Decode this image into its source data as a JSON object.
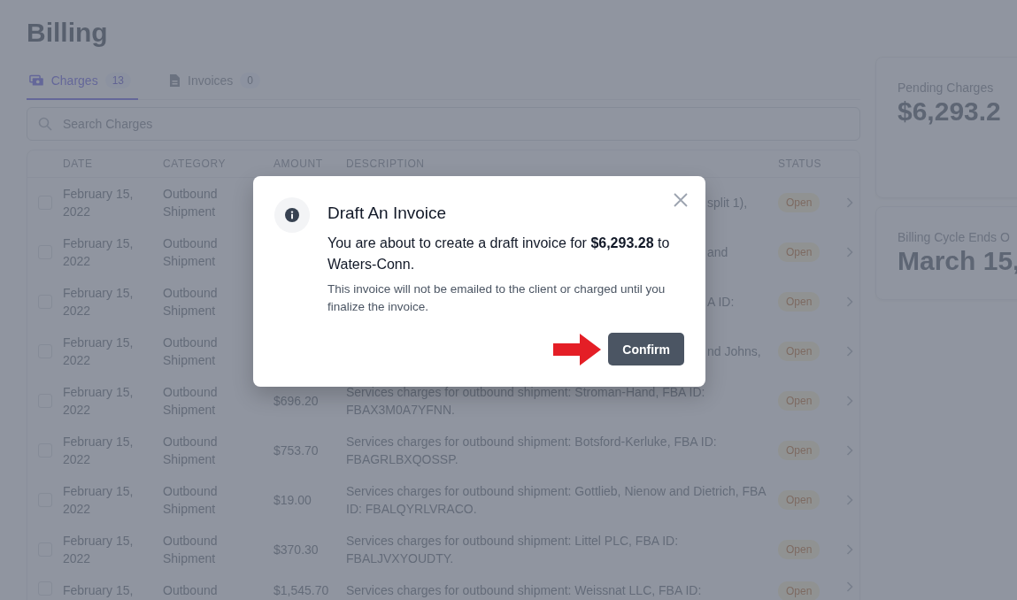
{
  "page": {
    "title": "Billing"
  },
  "tabs": [
    {
      "label": "Charges",
      "count": "13",
      "selected": true
    },
    {
      "label": "Invoices",
      "count": "0",
      "selected": false
    }
  ],
  "search": {
    "placeholder": "Search Charges"
  },
  "table": {
    "columns": [
      "DATE",
      "CATEGORY",
      "AMOUNT",
      "DESCRIPTION",
      "STATUS"
    ],
    "rows": [
      {
        "checked": false,
        "date": "February 15, 2022",
        "category": "Outbound Shipment",
        "description": "split 1),",
        "partly_covered": true,
        "status": "Open"
      },
      {
        "checked": false,
        "date": "February 15, 2022",
        "category": "Outbound Shipment",
        "description": "and",
        "partly_covered": true,
        "status": "Open"
      },
      {
        "checked": false,
        "date": "February 15, 2022",
        "category": "Outbound Shipment",
        "description": "A ID:",
        "partly_covered": true,
        "status": "Open"
      },
      {
        "checked": false,
        "date": "February 15, 2022",
        "category": "Outbound Shipment",
        "description": "nd Johns,",
        "partly_covered": true,
        "status": "Open"
      },
      {
        "checked": false,
        "date": "February 15, 2022",
        "category": "Outbound Shipment",
        "amount": "$696.20",
        "description": "Services charges for outbound shipment: Stroman-Hand, FBA ID: FBAX3M0A7YFNN.",
        "partly_covered": false,
        "status": "Open"
      },
      {
        "checked": false,
        "date": "February 15, 2022",
        "category": "Outbound Shipment",
        "amount": "$753.70",
        "description": "Services charges for outbound shipment: Botsford-Kerluke, FBA ID: FBAGRLBXQOSSP.",
        "partly_covered": false,
        "status": "Open"
      },
      {
        "checked": false,
        "date": "February 15, 2022",
        "category": "Outbound Shipment",
        "amount": "$19.00",
        "description": "Services charges for outbound shipment: Gottlieb, Nienow and Dietrich, FBA ID: FBALQYRLVRACO.",
        "partly_covered": false,
        "status": "Open"
      },
      {
        "checked": false,
        "date": "February 15, 2022",
        "category": "Outbound Shipment",
        "amount": "$370.30",
        "description": "Services charges for outbound shipment: Littel PLC, FBA ID: FBALJVXYOUDTY.",
        "partly_covered": false,
        "status": "Open"
      },
      {
        "checked": false,
        "date": "February 15,",
        "category": "Outbound",
        "amount": "$1,545.70",
        "description": "Services charges for outbound shipment: Weissnat LLC, FBA ID:",
        "partly_covered": false,
        "status": "Open"
      }
    ]
  },
  "stats": [
    {
      "label": "Pending Charges",
      "value": "$6,293.2"
    },
    {
      "label": "Billing Cycle Ends O",
      "value": "March 15,"
    }
  ],
  "dialog": {
    "title": "Draft An Invoice",
    "message": "You are about to create a draft invoice for **$6,293.28** to Waters-Conn.",
    "note": "This invoice will not be emailed to the client or charged until you finalize the invoice.",
    "button": "Confirm"
  }
}
